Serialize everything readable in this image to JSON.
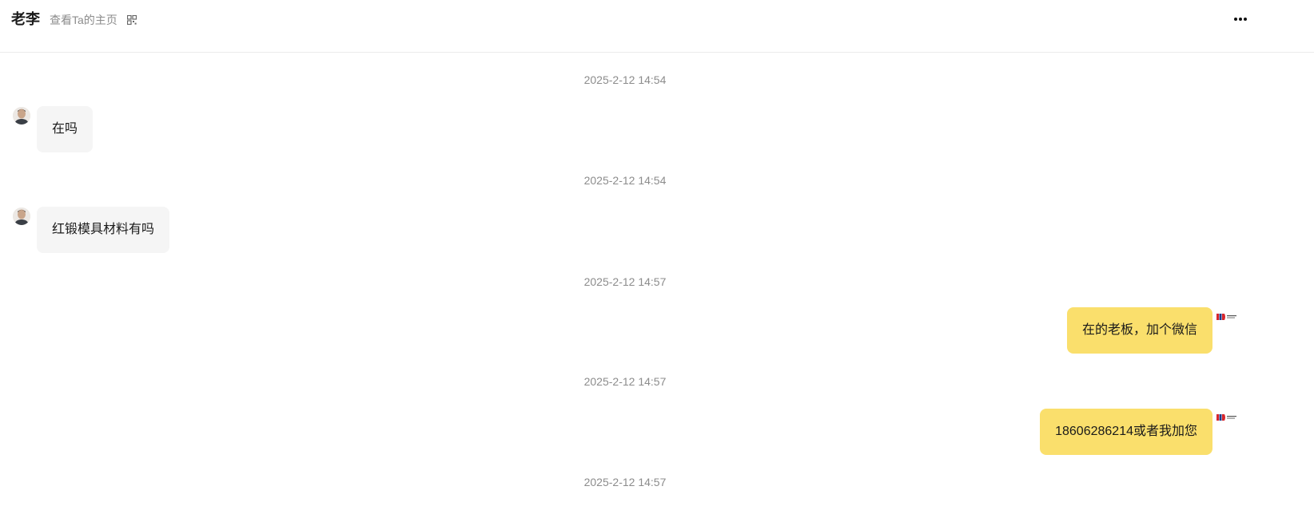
{
  "header": {
    "contact_name": "老李",
    "profile_link": "查看Ta的主页"
  },
  "messages": [
    {
      "time": "2025-2-12 14:54",
      "side": "left",
      "text": "在吗"
    },
    {
      "time": "2025-2-12 14:54",
      "side": "left",
      "text": "红锻模具材料有吗"
    },
    {
      "time": "2025-2-12 14:57",
      "side": "right",
      "text": "在的老板，加个微信"
    },
    {
      "time": "2025-2-12 14:57",
      "side": "right",
      "text": "18606286214或者我加您"
    },
    {
      "time": "2025-2-12 14:57"
    }
  ],
  "colors": {
    "outgoing_bubble": "#fadf6c",
    "incoming_bubble": "#f5f5f5",
    "muted_text": "#8c8c8c"
  },
  "icons": {
    "qr": "qr-code-icon",
    "more": "more-horizontal-icon"
  }
}
